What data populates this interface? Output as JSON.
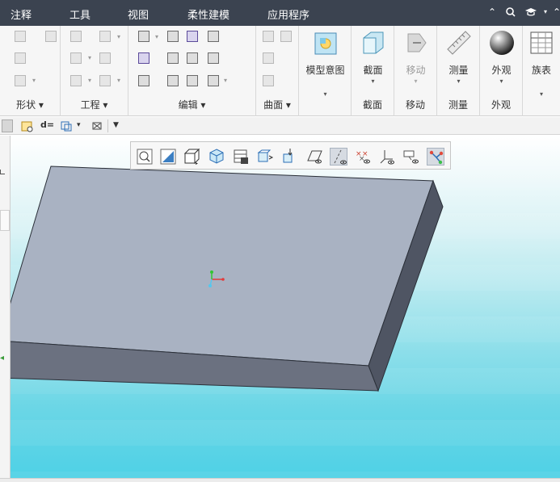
{
  "menubar": {
    "items": [
      "注释",
      "工具",
      "视图",
      "柔性建模",
      "应用程序"
    ],
    "right_icons": [
      "collapse-ribbon-icon",
      "search-icon",
      "help-icon"
    ]
  },
  "ribbon": {
    "groups": {
      "shape": {
        "label": "形状"
      },
      "engineering": {
        "label": "工程"
      },
      "edit": {
        "label": "编辑"
      },
      "surface": {
        "label": "曲面"
      },
      "model_intent": {
        "label": "模型意图"
      },
      "section": {
        "button": "截面",
        "label": "截面"
      },
      "move": {
        "button": "移动",
        "label": "移动"
      },
      "measure": {
        "button": "测量",
        "label": "测量"
      },
      "appearance": {
        "button": "外观",
        "label": "外观"
      },
      "family_table": {
        "button": "族表"
      }
    }
  },
  "quickbar": {
    "relation_label": "d="
  },
  "graphics_toolbar": {
    "icons": [
      "zoom-icon",
      "refit-icon",
      "display-style-icon",
      "saved-views-icon",
      "view-manager-icon",
      "perspective-icon",
      "spin-center-icon",
      "plane-display-icon",
      "axis-display-icon",
      "point-display-icon",
      "csys-display-icon",
      "annotation-display-icon",
      "repaint-icon"
    ]
  },
  "colors": {
    "menubar_bg": "#3b4350",
    "model_top": "#a9b2c2",
    "model_side": "#4f5563",
    "model_front": "#6b7180",
    "viewport_bottom": "#4ed1e6"
  }
}
